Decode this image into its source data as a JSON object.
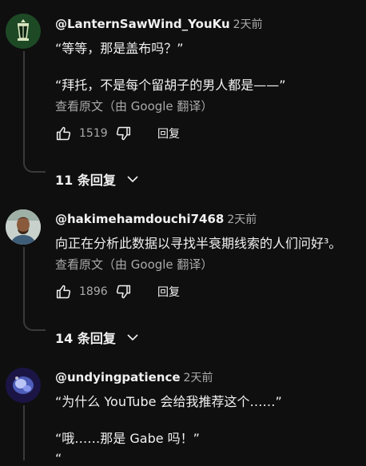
{
  "comments": [
    {
      "author": "@LanternSawWind_YouKu",
      "time": "2天前",
      "lines": [
        "“等等，那是盖布吗？”",
        "“拜托，不是每个留胡子的男人都是——”"
      ],
      "translate": "查看原文（由 Google 翻译）",
      "likes": "1519",
      "reply_label": "回复",
      "replies_label": "11 条回复"
    },
    {
      "author": "@hakimehamdouchi7468",
      "time": "2天前",
      "lines": [
        "向正在分析此数据以寻找半衰期线索的人们问好³。"
      ],
      "translate": "查看原文（由 Google 翻译）",
      "likes": "1896",
      "reply_label": "回复",
      "replies_label": "14 条回复"
    },
    {
      "author": "@undyingpatience",
      "time": "2天前",
      "lines": [
        "“为什么 YouTube 会给我推荐这个……”",
        "“哦……那是 Gabe 吗！”",
        "“"
      ]
    }
  ]
}
